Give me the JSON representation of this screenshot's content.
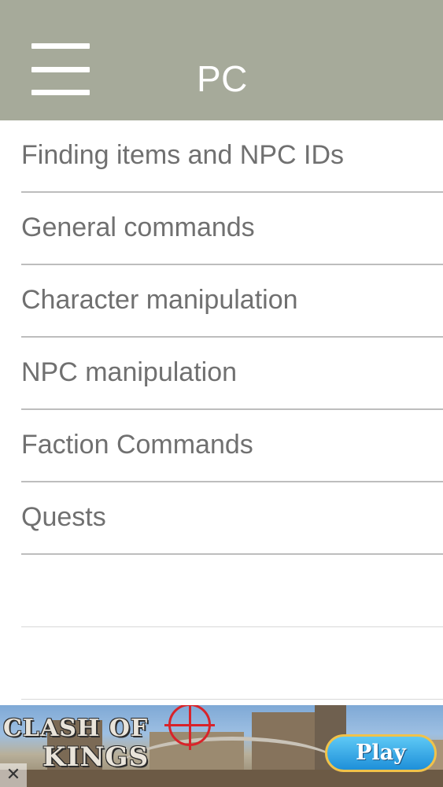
{
  "header": {
    "menu_icon": "hamburger-menu-icon",
    "title": "PC",
    "background_color": "#a6aa9a",
    "title_color": "#ffffff"
  },
  "list": {
    "items": [
      {
        "label": "Finding items and NPC IDs"
      },
      {
        "label": "General commands"
      },
      {
        "label": "Character manipulation"
      },
      {
        "label": "NPC manipulation"
      },
      {
        "label": "Faction Commands"
      },
      {
        "label": "Quests"
      }
    ],
    "text_color": "#707070",
    "divider_color": "#bdbdbd"
  },
  "ad": {
    "brand_line1": "CLASH OF",
    "brand_line2": "KINGS",
    "play_label": "Play",
    "close_label": "✕",
    "play_button_color": "#1e8fd9",
    "crosshair_color": "#d8232a"
  }
}
